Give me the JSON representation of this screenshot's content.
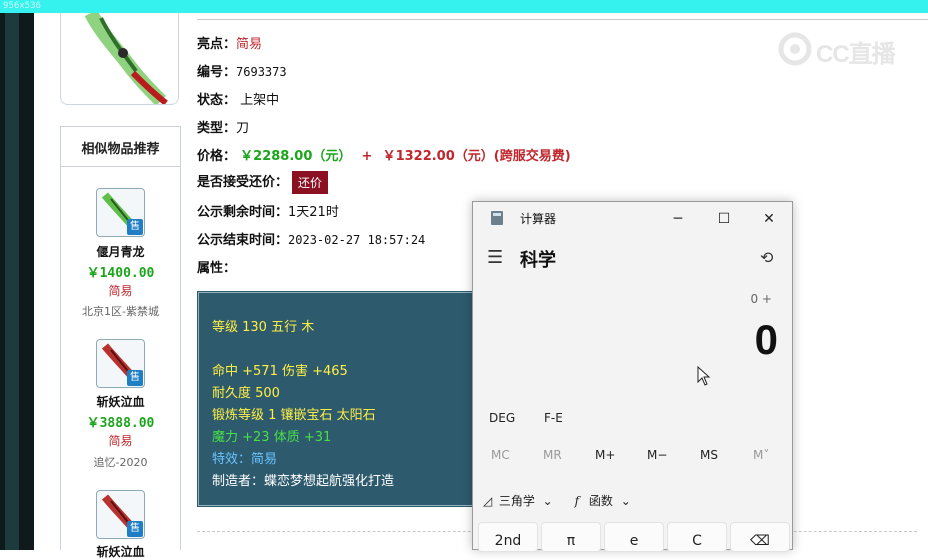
{
  "topbar": {
    "text": "956x536"
  },
  "listing": {
    "highlight_label": "亮点：",
    "highlight_value": "简易",
    "id_label": "编号：",
    "id_value": "7693373",
    "status_label": "状态：",
    "status_value": "上架中",
    "type_label": "类型：",
    "type_value": "刀",
    "price_label": "价格：",
    "price_value": "￥2288.00（元）",
    "price_plus": "+",
    "fee_value": "￥1322.00（元）(跨服交易费)",
    "offer_label": "是否接受还价：",
    "offer_button": "还价",
    "remaining_label": "公示剩余时间：",
    "remaining_value": "1天21时",
    "end_label": "公示结束时间：",
    "end_value": "2023-02-27 18:57:24",
    "attr_label": "属性："
  },
  "attributes": {
    "line1": "等级 130 五行 木",
    "line2": "命中 +571 伤害 +465",
    "line3": "耐久度 500",
    "line4": "锻炼等级 1 镶嵌宝石 太阳石",
    "line5": "魔力 +23 体质 +31",
    "line6": "特效：简易",
    "line7": "制造者：蝶恋梦想起航强化打造"
  },
  "recommend": {
    "title": "相似物品推荐",
    "badge": "售",
    "items": [
      {
        "name": "偃月青龙",
        "price": "￥1400.00",
        "tag": "简易",
        "server": "北京1区-紫禁城"
      },
      {
        "name": "斩妖泣血",
        "price": "￥3888.00",
        "tag": "简易",
        "server": "追忆-2020"
      },
      {
        "name": "斩妖泣血",
        "price": "",
        "tag": "",
        "server": ""
      }
    ]
  },
  "watermark": {
    "text": "CC直播"
  },
  "calculator": {
    "app_title": "计算器",
    "mode": "科学",
    "expression": "0 +",
    "display": "0",
    "deg": "DEG",
    "fe": "F-E",
    "memory": [
      "MC",
      "MR",
      "M+",
      "M−",
      "MS",
      "M˅"
    ],
    "trig": "三角学",
    "func": "函数",
    "keys": [
      "2nd",
      "π",
      "e",
      "C",
      "⌫"
    ]
  }
}
